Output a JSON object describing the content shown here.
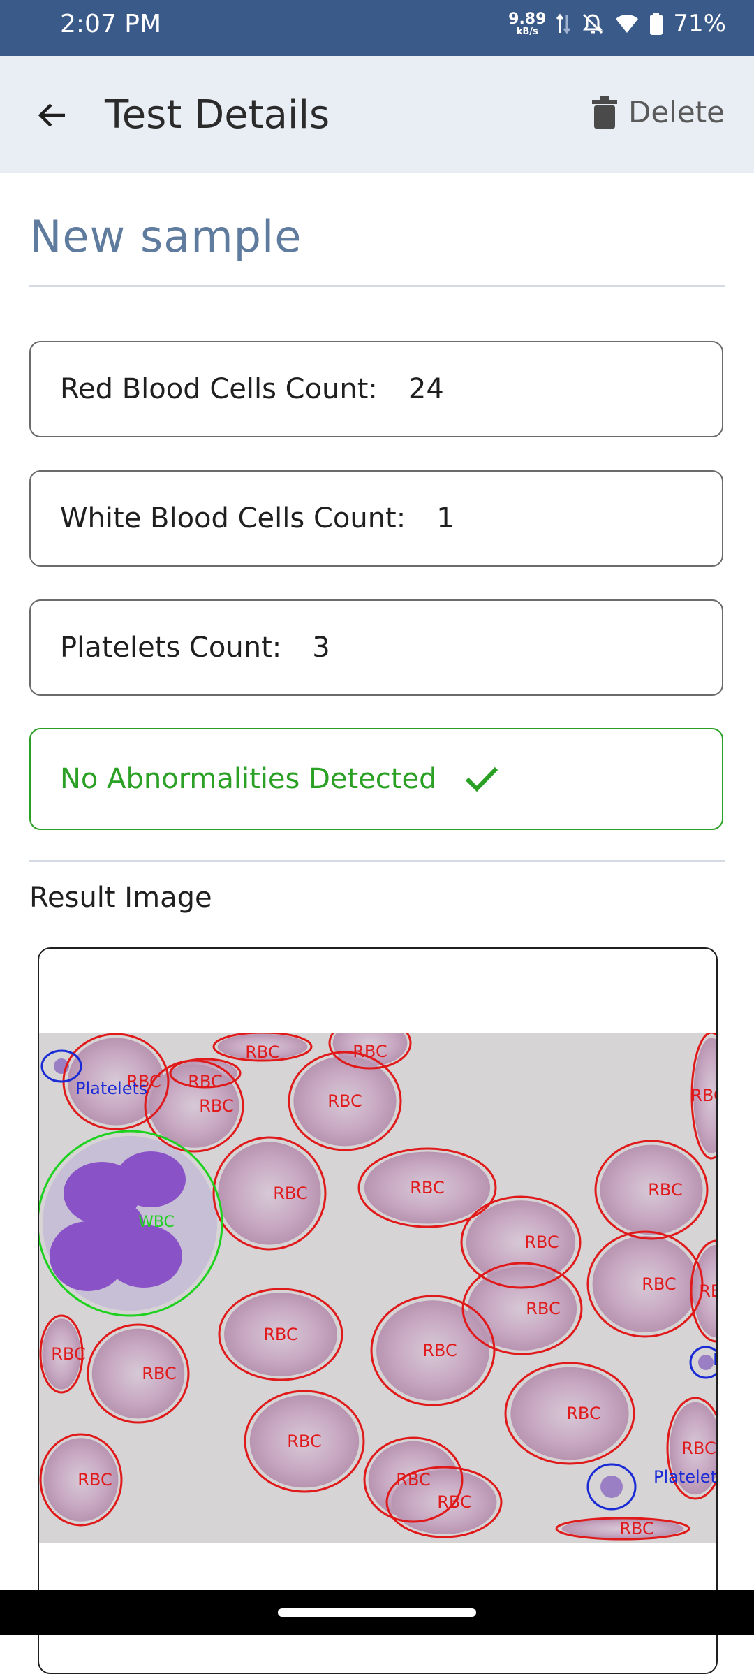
{
  "status_bar": {
    "time": "2:07 PM",
    "net_speed": "9.89",
    "net_unit": "kB/s",
    "battery": "71%"
  },
  "app_bar": {
    "title": "Test Details",
    "delete_label": "Delete"
  },
  "sample": {
    "title": "New sample"
  },
  "counts": [
    {
      "label": "Red Blood Cells Count:",
      "value": "24"
    },
    {
      "label": "White Blood Cells Count:",
      "value": "1"
    },
    {
      "label": "Platelets Count:",
      "value": "3"
    }
  ],
  "result": {
    "status": "No Abnormalities Detected",
    "section_label": "Result Image"
  },
  "detections": {
    "rbc_label": "RBC",
    "wbc_label": "WBC",
    "platelet_label": "Platelets",
    "rbc_color": "#e0191a",
    "wbc_color": "#1fd11f",
    "platelet_color": "#1a2bd6"
  },
  "colors": {
    "status_bar": "#3a5a8a",
    "app_bar": "#e9edf4",
    "accent_title": "#5f7c9f",
    "success": "#2aa024"
  }
}
